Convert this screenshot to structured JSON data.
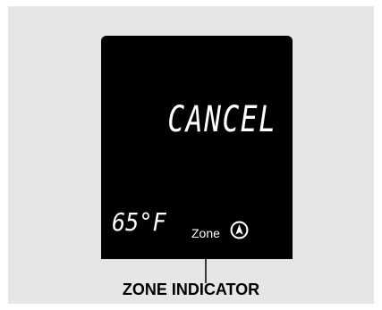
{
  "display": {
    "message": "CANCEL",
    "temperature": "65",
    "temperature_unit": "°F",
    "zone_label": "Zone",
    "zone_icon": "circled-arrow-up-icon"
  },
  "callout": {
    "label": "ZONE INDICATOR"
  },
  "colors": {
    "background": "#e6e6e6",
    "screen": "#000000",
    "segment": "#ffffff",
    "text": "#000000"
  }
}
